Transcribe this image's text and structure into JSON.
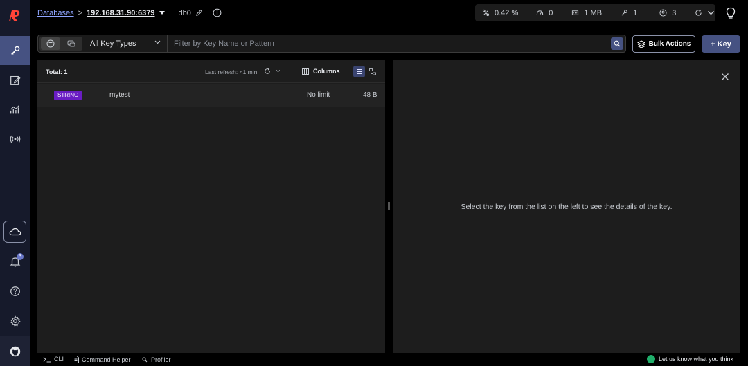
{
  "header": {
    "breadcrumb_root": "Databases",
    "breadcrumb_sep": ">",
    "host": "192.168.31.90:6379",
    "db": "db0"
  },
  "stats": {
    "cpu": "0.42 %",
    "ops": "0",
    "memory": "1 MB",
    "keys": "1",
    "clients": "3"
  },
  "toolbar": {
    "key_type": "All Key Types",
    "search_placeholder": "Filter by Key Name or Pattern",
    "bulk_actions": "Bulk Actions",
    "add_key": "+ Key"
  },
  "list": {
    "total": "Total: 1",
    "last_refresh": "Last refresh: <1 min",
    "columns_label": "Columns",
    "rows": [
      {
        "type": "STRING",
        "name": "mytest",
        "ttl": "No limit",
        "size": "48 B"
      }
    ]
  },
  "detail": {
    "empty_message": "Select the key from the list on the left to see the details of the key."
  },
  "notifications": {
    "count": "3"
  },
  "bottom": {
    "cli": "CLI",
    "command_helper": "Command Helper",
    "profiler": "Profiler",
    "feedback": "Let us know what you think"
  }
}
